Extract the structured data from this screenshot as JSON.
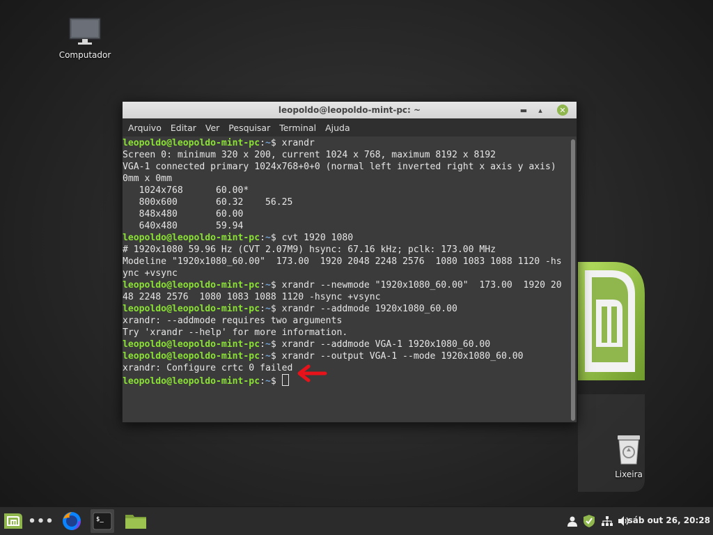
{
  "desktop": {
    "computer_label": "Computador",
    "trash_label": "Lixeira"
  },
  "terminal": {
    "title": "leopoldo@leopoldo-mint-pc: ~",
    "menu": [
      "Arquivo",
      "Editar",
      "Ver",
      "Pesquisar",
      "Terminal",
      "Ajuda"
    ],
    "prompt_user": "leopoldo@leopoldo-mint-pc",
    "prompt_path": "~",
    "prompt_symbol": "$",
    "lines": [
      {
        "type": "prompt",
        "text": " xrandr"
      },
      {
        "type": "out",
        "text": "Screen 0: minimum 320 x 200, current 1024 x 768, maximum 8192 x 8192"
      },
      {
        "type": "out",
        "text": "VGA-1 connected primary 1024x768+0+0 (normal left inverted right x axis y axis)"
      },
      {
        "type": "out",
        "text": "0mm x 0mm"
      },
      {
        "type": "out",
        "text": "   1024x768      60.00*"
      },
      {
        "type": "out",
        "text": "   800x600       60.32    56.25"
      },
      {
        "type": "out",
        "text": "   848x480       60.00"
      },
      {
        "type": "out",
        "text": "   640x480       59.94"
      },
      {
        "type": "prompt",
        "text": " cvt 1920 1080"
      },
      {
        "type": "out",
        "text": "# 1920x1080 59.96 Hz (CVT 2.07M9) hsync: 67.16 kHz; pclk: 173.00 MHz"
      },
      {
        "type": "out",
        "text": "Modeline \"1920x1080_60.00\"  173.00  1920 2048 2248 2576  1080 1083 1088 1120 -hs"
      },
      {
        "type": "out",
        "text": "ync +vsync"
      },
      {
        "type": "prompt",
        "text": " xrandr --newmode \"1920x1080_60.00\"  173.00  1920 20"
      },
      {
        "type": "out",
        "text": "48 2248 2576  1080 1083 1088 1120 -hsync +vsync"
      },
      {
        "type": "prompt",
        "text": " xrandr --addmode 1920x1080_60.00"
      },
      {
        "type": "out",
        "text": "xrandr: --addmode requires two arguments"
      },
      {
        "type": "out",
        "text": "Try 'xrandr --help' for more information."
      },
      {
        "type": "prompt",
        "text": " xrandr --addmode VGA-1 1920x1080_60.00"
      },
      {
        "type": "prompt",
        "text": " xrandr --output VGA-1 --mode 1920x1080_60.00"
      },
      {
        "type": "out",
        "text": "xrandr: Configure crtc 0 failed"
      },
      {
        "type": "cursor",
        "text": " "
      }
    ]
  },
  "taskbar": {
    "dots": "•••",
    "clock": "sáb out 26, 20:28",
    "terminal_glyph": "$_"
  },
  "colors": {
    "prompt_user": "#8ae234",
    "prompt_path": "#729fcf",
    "mint_green": "#8fb74d",
    "arrow_red": "#e8121a"
  },
  "icons": [
    "computer-icon",
    "trash-icon",
    "mint-logo-icon",
    "firefox-icon",
    "terminal-icon",
    "folder-icon",
    "user-icon",
    "shield-icon",
    "network-icon",
    "volume-icon"
  ]
}
